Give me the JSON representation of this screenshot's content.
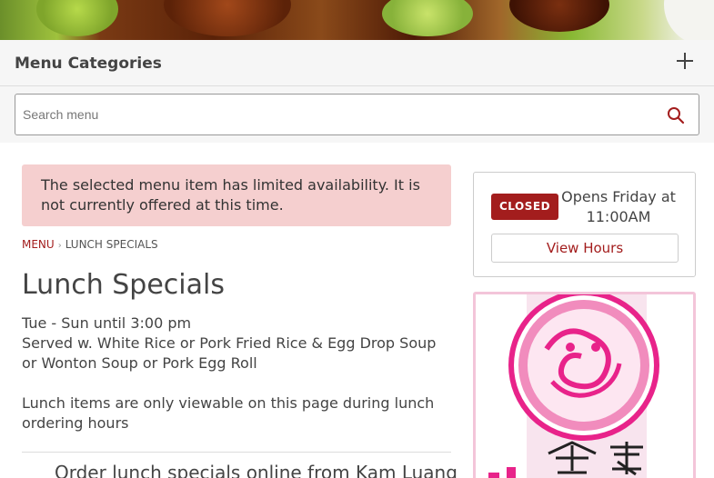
{
  "menu_categories": {
    "title": "Menu Categories",
    "expand_icon": "plus-icon"
  },
  "search": {
    "placeholder": "Search menu",
    "icon": "search-icon"
  },
  "alert": {
    "message": "The selected menu item has limited availability. It is not currently offered at this time."
  },
  "breadcrumb": {
    "root": "MENU",
    "current": "LUNCH SPECIALS"
  },
  "category": {
    "title": "Lunch Specials",
    "description_lines": [
      "Tue - Sun until 3:00 pm",
      "Served w. White Rice or Pork Fried Rice & Egg Drop Soup or Wonton Soup or Pork Egg Roll",
      "Lunch items are only viewable on this page during lunch ordering hours"
    ],
    "link_text": "Order lunch specials online from Kam Luang"
  },
  "hours": {
    "status": "CLOSED",
    "opens": "Opens Friday at 11:00AM",
    "button": "View Hours"
  },
  "colors": {
    "accent": "#a31d1d",
    "alert_bg": "#f5cfcf",
    "logo_pink": "#e8238a"
  }
}
